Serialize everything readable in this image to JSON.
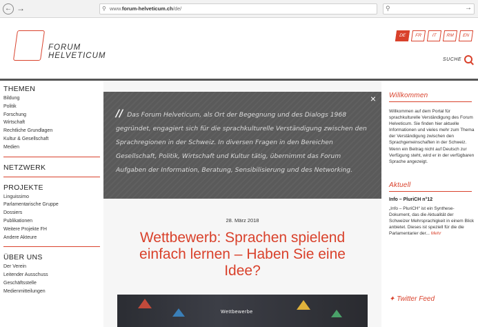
{
  "browser": {
    "back_icon": "back-arrow-icon",
    "forward_icon": "forward-arrow-icon",
    "url_prefix": "www.",
    "url_domain": "forum-helveticum.ch",
    "url_path": "/de/",
    "search_go": "→"
  },
  "header": {
    "logo_line1": "FORUM",
    "logo_line2": "HELVETICUM",
    "languages": [
      "DE",
      "FR",
      "IT",
      "RM",
      "EN"
    ],
    "active_language": "DE",
    "search_label": "SUCHE"
  },
  "sidebar": {
    "themen_title": "THEMEN",
    "themen": [
      "Bildung",
      "Politik",
      "Forschung",
      "Wirtschaft",
      "Rechtliche Grundlagen",
      "Kultur & Gesellschaft",
      "Medien"
    ],
    "netzwerk_title": "NETZWERK",
    "projekte_title": "PROJEKTE",
    "projekte": [
      "Linguissimo",
      "Parlamentarische Gruppe",
      "Dossiers",
      "Publikationen",
      "Weitere Projekte FH",
      "Andere Akteure"
    ],
    "ueber_title": "ÜBER UNS",
    "ueber": [
      "Der Verein",
      "Leitender Ausschuss",
      "Geschäftsstelle",
      "Medienmitteilungen"
    ]
  },
  "main": {
    "quote": "Das Forum Helveticum, als Ort der Begegnung und des Dialogs 1968 gegründet, engagiert sich für die sprachkulturelle Verständigung zwischen den Sprachregionen in der Schweiz. In diversen Fragen in den Bereichen Gesellschaft, Politik, Wirtschaft und Kultur tätig, übernimmt das Forum Aufgaben der Information, Beratung, Sensibilisierung und des Networking.",
    "close": "×",
    "date": "28. März 2018",
    "headline": "Wettbewerb: Sprachen spielend einfach lernen – Haben Sie eine Idee?",
    "image_label": "Wettbewerbe"
  },
  "right": {
    "welcome_title": "Willkommen",
    "welcome_text": "Willkommen auf dem Portal für sprachkulturelle Verständigung des Forum Helveticum. Sie finden hier aktuelle Informationen und vieles mehr zum Thema der Verständigung zwischen den Sprachgemeinschaften in der Schweiz.",
    "welcome_text2": "Wenn ein Beitrag nicht auf Deutsch zur Verfügung steht, wird er in der verfügbaren Sprache angezeigt.",
    "aktuell_title": "Aktuell",
    "aktuell_sub": "Info – PluriCH n°12",
    "aktuell_text": "„Info – PluriCH“ ist ein Synthese-Dokument, das die Aktualität der Schweizer Mehrsprachigkeit in einem Blick anbietet. Dieses ist speziell für die die Parlamentarier der...",
    "aktuell_more": "Mehr",
    "twitter_title": "Twitter Feed"
  }
}
